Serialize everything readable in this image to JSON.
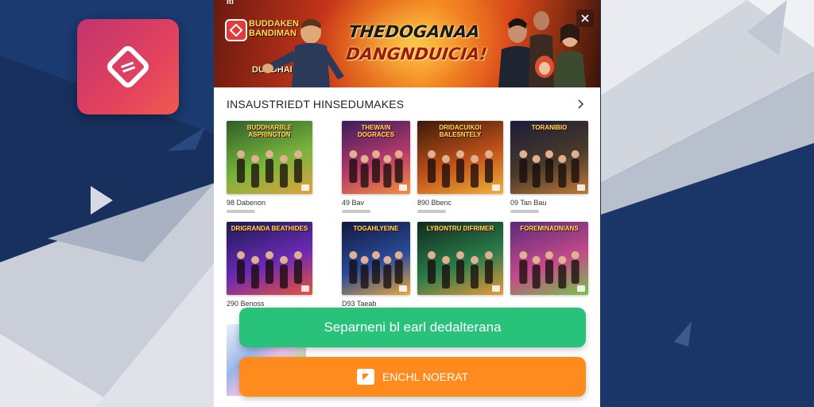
{
  "status_bar": {
    "label": "Iti"
  },
  "banner": {
    "small_title": "BUDDAKEN BANDIMAN",
    "caption": "DURDHAIAN",
    "title_line1": "THEDOGANAA",
    "title_line2": "DANGNDUICIA!"
  },
  "section": {
    "title": "INSAUSTRIEDT HINSEDUMAKES"
  },
  "games": [
    {
      "name": "BUDDHARBLE ASPRINGTON",
      "label": "98 Dabenon",
      "colors": [
        "#2f5e2a",
        "#78b43c",
        "#e0a23c"
      ]
    },
    {
      "name": "THEWAIN DOGRACES",
      "label": "49 Bav",
      "colors": [
        "#3a1c5c",
        "#b63a6a",
        "#f29040"
      ]
    },
    {
      "name": "DRIDACUIKOI BALESNTELY",
      "label": "890 Bbenc",
      "colors": [
        "#3a1a0a",
        "#c0521a",
        "#f2b23a"
      ]
    },
    {
      "name": "TORANIBIO",
      "label": "09 Tan Bau",
      "colors": [
        "#1a1c3a",
        "#4a3a2a",
        "#c07a3a"
      ]
    },
    {
      "name": "DRIGRANDA BEATHIDES",
      "label": "290 Benoss",
      "colors": [
        "#1c1a52",
        "#6a2ab4",
        "#e8523a"
      ]
    },
    {
      "name": "TOGAHLYEINE",
      "label": "D93 Taeab",
      "colors": [
        "#101a3c",
        "#2a4a9a",
        "#e8a83a"
      ]
    },
    {
      "name": "LYBONTRU DIFRIMER",
      "label": "",
      "colors": [
        "#102a1c",
        "#2a7a4a",
        "#e89a3a"
      ]
    },
    {
      "name": "FOREMINADNIANS",
      "label": "",
      "colors": [
        "#5a2a7a",
        "#c24a8a",
        "#7ac24a"
      ]
    }
  ],
  "buttons": {
    "primary_label": "Separneni bl earl dedalterana",
    "secondary_label": "ENCHL NOERAT"
  },
  "colors": {
    "background": "#17305e",
    "app_icon": "#e2425e",
    "green": "#28c27a",
    "orange": "#ff8a1e"
  }
}
